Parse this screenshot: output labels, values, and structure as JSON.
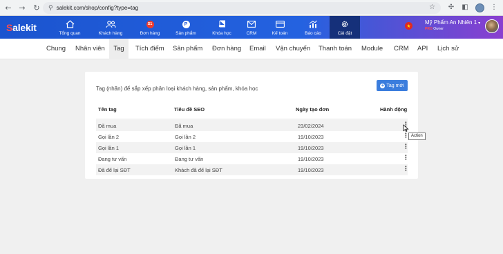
{
  "browser": {
    "url": "salekit.com/shop/config?type=tag"
  },
  "header": {
    "logo_prefix": "S",
    "logo_rest": "alekit",
    "nav": [
      {
        "label": "Tổng quan",
        "icon": "home-icon"
      },
      {
        "label": "Khách hàng",
        "icon": "users-icon"
      },
      {
        "label": "Đơn hàng",
        "icon": "orders-badge-icon",
        "badge": "S1"
      },
      {
        "label": "Sản phẩm",
        "icon": "product-badge-icon",
        "badge": "P"
      },
      {
        "label": "Khóa học",
        "icon": "book-icon"
      },
      {
        "label": "CRM",
        "icon": "mail-icon"
      },
      {
        "label": "Kế toán",
        "icon": "wallet-icon"
      },
      {
        "label": "Báo cáo",
        "icon": "chart-icon"
      },
      {
        "label": "Cài đặt",
        "icon": "gear-icon",
        "active": true
      }
    ],
    "user": {
      "name": "Mỹ Phẩm An Nhiên 1",
      "plan": "PRO",
      "role": "Owner"
    }
  },
  "subnav": {
    "tabs": [
      "Chung",
      "Nhân viên",
      "Tag",
      "Tích điểm",
      "Sản phẩm",
      "Đơn hàng",
      "Email",
      "Vận chuyển",
      "Thanh toán",
      "Module",
      "CRM",
      "API",
      "Lịch sử"
    ],
    "active": "Tag"
  },
  "card": {
    "description": "Tag (nhãn) để sắp xếp phân loại khách hàng, sản phẩm, khóa học",
    "add_button": "Tag mới",
    "columns": [
      "Tên tag",
      "Tiêu đề SEO",
      "Ngày tạo đơn",
      "Hành động"
    ],
    "rows": [
      {
        "name": "Đã mua",
        "seo": "Đã mua",
        "date": "23/02/2024"
      },
      {
        "name": "Gọi lần 2",
        "seo": "Gọi lần 2",
        "date": "19/10/2023"
      },
      {
        "name": "Gọi lần 1",
        "seo": "Gọi lần 1",
        "date": "19/10/2023"
      },
      {
        "name": "Đang tư vấn",
        "seo": "Đang tư vấn",
        "date": "19/10/2023"
      },
      {
        "name": "Đã để lại SĐT",
        "seo": "Khách đã để lại SĐT",
        "date": "19/10/2023"
      }
    ]
  },
  "tooltip": "Action",
  "colors": {
    "header_blue": "#1b54cf",
    "header_purple": "#8a3fd0",
    "button_blue": "#3b7ddd",
    "active_nav": "#15307a"
  }
}
